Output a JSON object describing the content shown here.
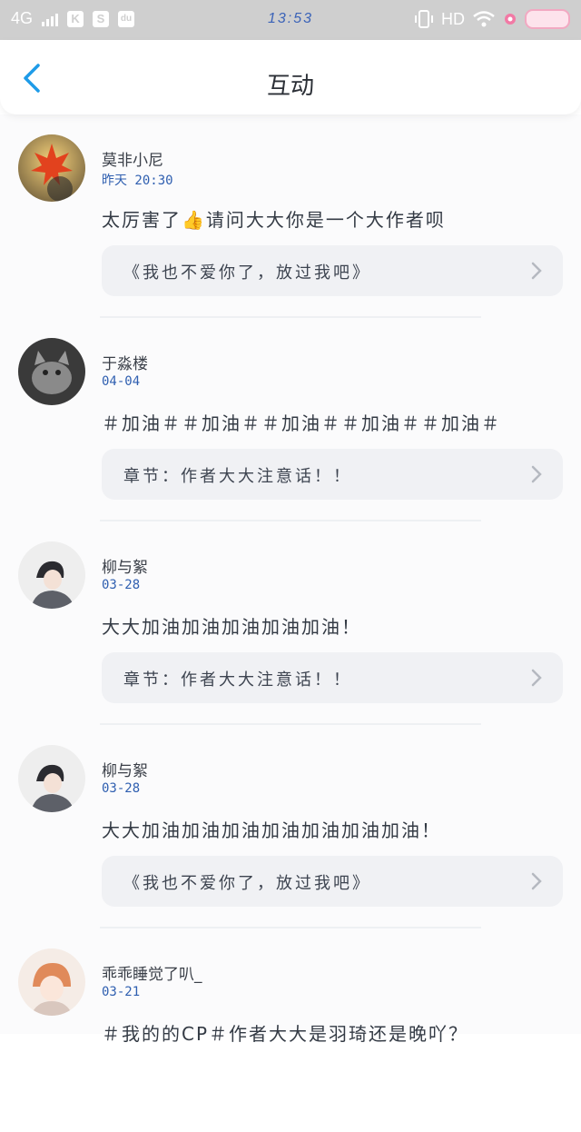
{
  "status_bar": {
    "network": "4G",
    "app_icon_1": "K",
    "app_icon_2": "S",
    "app_icon_3": "du",
    "time": "13:53",
    "hd_label": "HD"
  },
  "nav": {
    "title": "互动"
  },
  "items": [
    {
      "username": "莫非小尼",
      "date": "昨天 20:30",
      "comment": "太厉害了👍请问大大你是一个大作者呗",
      "reference": "《我也不爱你了，放过我吧》"
    },
    {
      "username": "于淼楼",
      "date": "04-04",
      "comment": "＃加油＃＃加油＃＃加油＃＃加油＃＃加油＃",
      "reference": "章节：作者大大注意话！！"
    },
    {
      "username": "柳与絮",
      "date": "03-28",
      "comment": "大大加油加油加油加油加油！",
      "reference": "章节：作者大大注意话！！"
    },
    {
      "username": "柳与絮",
      "date": "03-28",
      "comment": "大大加油加油加油加油加油加油加油！",
      "reference": "《我也不爱你了，放过我吧》"
    },
    {
      "username": "乖乖睡觉了叭_",
      "date": "03-21",
      "comment": "＃我的的CP＃作者大大是羽琦还是晚吖？",
      "reference": ""
    }
  ],
  "colors": {
    "accent": "#1e9be8",
    "date_text": "#2f5fb0",
    "card_bg": "#f0f1f4"
  }
}
